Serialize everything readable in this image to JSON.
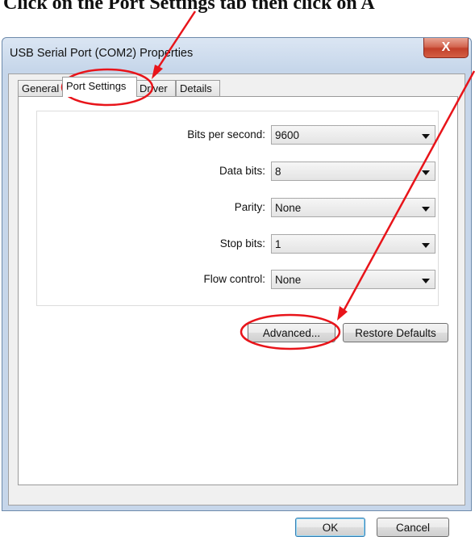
{
  "instruction": {
    "prefix": "Click on the ",
    "emphasis": "Port Settings",
    "suffix": " tab then click on A"
  },
  "window": {
    "title": "USB Serial Port (COM2) Properties",
    "close_glyph": "X"
  },
  "tabs": [
    {
      "label": "General",
      "active": false
    },
    {
      "label": "Port Settings",
      "active": true
    },
    {
      "label": "Driver",
      "active": false
    },
    {
      "label": "Details",
      "active": false
    }
  ],
  "settings": [
    {
      "label": "Bits per second:",
      "value": "9600"
    },
    {
      "label": "Data bits:",
      "value": "8"
    },
    {
      "label": "Parity:",
      "value": "None"
    },
    {
      "label": "Stop bits:",
      "value": "1"
    },
    {
      "label": "Flow control:",
      "value": "None"
    }
  ],
  "buttons": {
    "advanced": "Advanced...",
    "restore_defaults": "Restore Defaults",
    "ok": "OK",
    "cancel": "Cancel"
  },
  "icons": {
    "dropdown": "chevron-down-icon",
    "close": "close-icon"
  },
  "colors": {
    "annotation": "#e8141a",
    "window_frame": "#c6d6ea",
    "close_button": "#c2402a"
  }
}
